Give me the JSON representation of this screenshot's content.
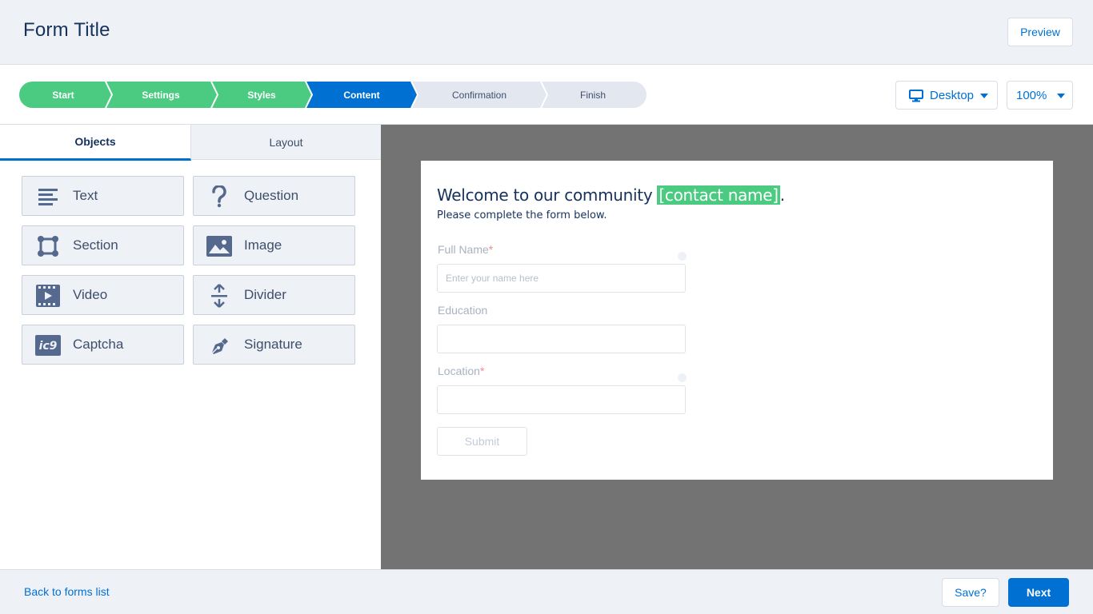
{
  "header": {
    "title": "Form Title",
    "preview_label": "Preview"
  },
  "steps": [
    {
      "label": "Start",
      "state": "done"
    },
    {
      "label": "Settings",
      "state": "done"
    },
    {
      "label": "Styles",
      "state": "done"
    },
    {
      "label": "Content",
      "state": "active"
    },
    {
      "label": "Confirmation",
      "state": "todo"
    },
    {
      "label": "Finish",
      "state": "todo"
    }
  ],
  "device_select": {
    "value": "Desktop",
    "icon": "monitor-icon"
  },
  "zoom_select": {
    "value": "100%"
  },
  "panel": {
    "tabs": [
      {
        "label": "Objects",
        "active": true
      },
      {
        "label": "Layout",
        "active": false
      }
    ],
    "objects": [
      {
        "label": "Text",
        "icon": "text-lines-icon"
      },
      {
        "label": "Question",
        "icon": "question-mark-icon"
      },
      {
        "label": "Section",
        "icon": "section-frame-icon"
      },
      {
        "label": "Image",
        "icon": "image-icon"
      },
      {
        "label": "Video",
        "icon": "video-icon"
      },
      {
        "label": "Divider",
        "icon": "divider-arrows-icon"
      },
      {
        "label": "Captcha",
        "icon": "captcha-icon"
      },
      {
        "label": "Signature",
        "icon": "signature-pen-icon"
      }
    ]
  },
  "form": {
    "welcome": "Welcome to our community ",
    "merge_field": "[contact name]",
    "welcome_end": ".",
    "subtext": "Please complete the form below.",
    "fields": [
      {
        "label": "Full Name",
        "required": "*",
        "placeholder": "Enter your name here"
      },
      {
        "label": "Education",
        "required": "",
        "placeholder": ""
      },
      {
        "label": "Location",
        "required": "*",
        "placeholder": ""
      }
    ],
    "submit_label": "Submit"
  },
  "footer": {
    "back_label": "Back to forms list",
    "save_label": "Save?",
    "next_label": "Next"
  },
  "colors": {
    "done_step": "#4bca81",
    "active_step": "#0070d2",
    "todo_step": "#e3e8f0",
    "canvas_bg": "#737373"
  }
}
